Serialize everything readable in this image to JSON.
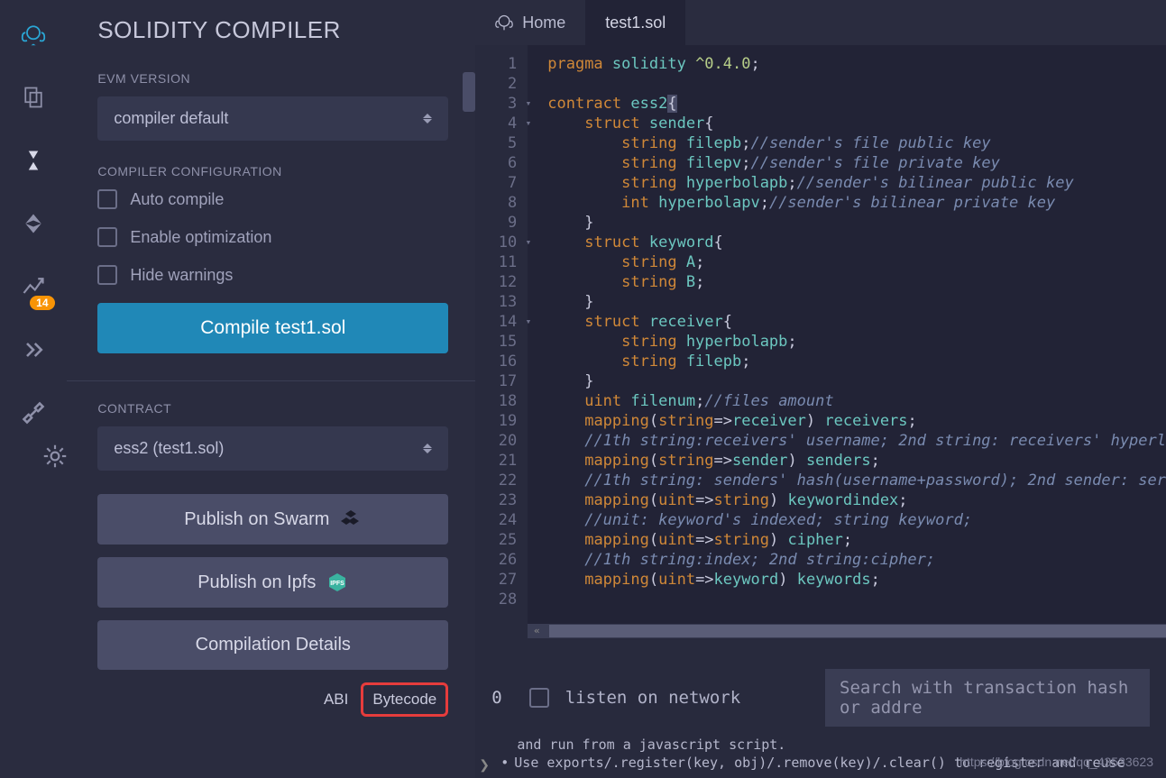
{
  "sidebar": {
    "title": "SOLIDITY COMPILER",
    "evm_label": "EVM VERSION",
    "evm_value": "compiler default",
    "config_label": "COMPILER CONFIGURATION",
    "auto_compile": "Auto compile",
    "enable_opt": "Enable optimization",
    "hide_warnings": "Hide warnings",
    "compile_btn": "Compile test1.sol",
    "contract_label": "CONTRACT",
    "contract_value": "ess2 (test1.sol)",
    "publish_swarm": "Publish on Swarm",
    "publish_ipfs": "Publish on Ipfs",
    "comp_details": "Compilation Details",
    "abi": "ABI",
    "bytecode": "Bytecode"
  },
  "rail": {
    "badge": "14"
  },
  "tabs": {
    "home": "Home",
    "file": "test1.sol"
  },
  "terminal": {
    "count": "0",
    "listen": "listen on network",
    "search_placeholder": "Search with transaction hash or addre",
    "line1": "and run from a javascript script.",
    "line2": "Use exports/.register(key, obj)/.remove(key)/.clear() to register and reuse"
  },
  "watermark": "https://blog.csdn.net/qq_43533623",
  "chart_data": null,
  "code_lines": [
    {
      "n": 1,
      "t": [
        [
          "kw",
          "pragma"
        ],
        [
          "sp",
          " "
        ],
        [
          "id",
          "solidity"
        ],
        [
          "sp",
          " "
        ],
        [
          "str",
          "^0.4.0"
        ],
        [
          "punc",
          ";"
        ]
      ]
    },
    {
      "n": 2,
      "t": []
    },
    {
      "n": 3,
      "fold": true,
      "t": [
        [
          "kw",
          "contract"
        ],
        [
          "sp",
          " "
        ],
        [
          "id",
          "ess2"
        ],
        [
          "hl",
          "{"
        ]
      ]
    },
    {
      "n": 4,
      "fold": true,
      "indent": 1,
      "t": [
        [
          "kw",
          "struct"
        ],
        [
          "sp",
          " "
        ],
        [
          "id",
          "sender"
        ],
        [
          "punc",
          "{"
        ]
      ]
    },
    {
      "n": 5,
      "indent": 2,
      "t": [
        [
          "type",
          "string"
        ],
        [
          "sp",
          " "
        ],
        [
          "id",
          "filepb"
        ],
        [
          "punc",
          ";"
        ],
        [
          "com",
          "//sender's file public key"
        ]
      ]
    },
    {
      "n": 6,
      "indent": 2,
      "t": [
        [
          "type",
          "string"
        ],
        [
          "sp",
          " "
        ],
        [
          "id",
          "filepv"
        ],
        [
          "punc",
          ";"
        ],
        [
          "com",
          "//sender's file private key"
        ]
      ]
    },
    {
      "n": 7,
      "indent": 2,
      "t": [
        [
          "type",
          "string"
        ],
        [
          "sp",
          " "
        ],
        [
          "id",
          "hyperbolapb"
        ],
        [
          "punc",
          ";"
        ],
        [
          "com",
          "//sender's bilinear public key"
        ]
      ]
    },
    {
      "n": 8,
      "indent": 2,
      "t": [
        [
          "type",
          "int"
        ],
        [
          "sp",
          " "
        ],
        [
          "id",
          "hyperbolapv"
        ],
        [
          "punc",
          ";"
        ],
        [
          "com",
          "//sender's bilinear private key"
        ]
      ]
    },
    {
      "n": 9,
      "indent": 1,
      "t": [
        [
          "punc",
          "}"
        ]
      ]
    },
    {
      "n": 10,
      "fold": true,
      "indent": 1,
      "t": [
        [
          "kw",
          "struct"
        ],
        [
          "sp",
          " "
        ],
        [
          "id",
          "keyword"
        ],
        [
          "punc",
          "{"
        ]
      ]
    },
    {
      "n": 11,
      "indent": 2,
      "t": [
        [
          "type",
          "string"
        ],
        [
          "sp",
          " "
        ],
        [
          "id",
          "A"
        ],
        [
          "punc",
          ";"
        ]
      ]
    },
    {
      "n": 12,
      "indent": 2,
      "t": [
        [
          "type",
          "string"
        ],
        [
          "sp",
          " "
        ],
        [
          "id",
          "B"
        ],
        [
          "punc",
          ";"
        ]
      ]
    },
    {
      "n": 13,
      "indent": 1,
      "t": [
        [
          "punc",
          "}"
        ]
      ]
    },
    {
      "n": 14,
      "fold": true,
      "indent": 1,
      "t": [
        [
          "kw",
          "struct"
        ],
        [
          "sp",
          " "
        ],
        [
          "id",
          "receiver"
        ],
        [
          "punc",
          "{"
        ]
      ]
    },
    {
      "n": 15,
      "indent": 2,
      "t": [
        [
          "type",
          "string"
        ],
        [
          "sp",
          " "
        ],
        [
          "id",
          "hyperbolapb"
        ],
        [
          "punc",
          ";"
        ]
      ]
    },
    {
      "n": 16,
      "indent": 2,
      "t": [
        [
          "type",
          "string"
        ],
        [
          "sp",
          " "
        ],
        [
          "id",
          "filepb"
        ],
        [
          "punc",
          ";"
        ]
      ]
    },
    {
      "n": 17,
      "indent": 1,
      "t": [
        [
          "punc",
          "}"
        ]
      ]
    },
    {
      "n": 18,
      "indent": 1,
      "t": [
        [
          "type",
          "uint"
        ],
        [
          "sp",
          " "
        ],
        [
          "id",
          "filenum"
        ],
        [
          "punc",
          ";"
        ],
        [
          "com",
          "//files amount"
        ]
      ]
    },
    {
      "n": 19,
      "indent": 1,
      "t": [
        [
          "kw",
          "mapping"
        ],
        [
          "punc",
          "("
        ],
        [
          "type",
          "string"
        ],
        [
          "punc",
          "=>"
        ],
        [
          "id",
          "receiver"
        ],
        [
          "punc",
          ")"
        ],
        [
          "sp",
          " "
        ],
        [
          "id",
          "receivers"
        ],
        [
          "punc",
          ";"
        ]
      ]
    },
    {
      "n": 20,
      "indent": 1,
      "t": [
        [
          "com",
          "//1th string:receivers' username; 2nd string: receivers' hyperl"
        ]
      ]
    },
    {
      "n": 21,
      "indent": 1,
      "t": [
        [
          "kw",
          "mapping"
        ],
        [
          "punc",
          "("
        ],
        [
          "type",
          "string"
        ],
        [
          "punc",
          "=>"
        ],
        [
          "id",
          "sender"
        ],
        [
          "punc",
          ")"
        ],
        [
          "sp",
          " "
        ],
        [
          "id",
          "senders"
        ],
        [
          "punc",
          ";"
        ]
      ]
    },
    {
      "n": 22,
      "indent": 1,
      "t": [
        [
          "com",
          "//1th string: senders' hash(username+password); 2nd sender: ser"
        ]
      ]
    },
    {
      "n": 23,
      "indent": 1,
      "t": [
        [
          "kw",
          "mapping"
        ],
        [
          "punc",
          "("
        ],
        [
          "type",
          "uint"
        ],
        [
          "punc",
          "=>"
        ],
        [
          "type",
          "string"
        ],
        [
          "punc",
          ")"
        ],
        [
          "sp",
          " "
        ],
        [
          "id",
          "keywordindex"
        ],
        [
          "punc",
          ";"
        ]
      ]
    },
    {
      "n": 24,
      "indent": 1,
      "t": [
        [
          "com",
          "//unit: keyword's indexed; string keyword;"
        ]
      ]
    },
    {
      "n": 25,
      "indent": 1,
      "t": [
        [
          "kw",
          "mapping"
        ],
        [
          "punc",
          "("
        ],
        [
          "type",
          "uint"
        ],
        [
          "punc",
          "=>"
        ],
        [
          "type",
          "string"
        ],
        [
          "punc",
          ")"
        ],
        [
          "sp",
          " "
        ],
        [
          "id",
          "cipher"
        ],
        [
          "punc",
          ";"
        ]
      ]
    },
    {
      "n": 26,
      "indent": 1,
      "t": [
        [
          "com",
          "//1th string:index; 2nd string:cipher;"
        ]
      ]
    },
    {
      "n": 27,
      "indent": 1,
      "t": [
        [
          "kw",
          "mapping"
        ],
        [
          "punc",
          "("
        ],
        [
          "type",
          "uint"
        ],
        [
          "punc",
          "=>"
        ],
        [
          "id",
          "keyword"
        ],
        [
          "punc",
          ")"
        ],
        [
          "sp",
          " "
        ],
        [
          "id",
          "keywords"
        ],
        [
          "punc",
          ";"
        ]
      ]
    },
    {
      "n": 28,
      "indent": 0,
      "t": []
    }
  ]
}
